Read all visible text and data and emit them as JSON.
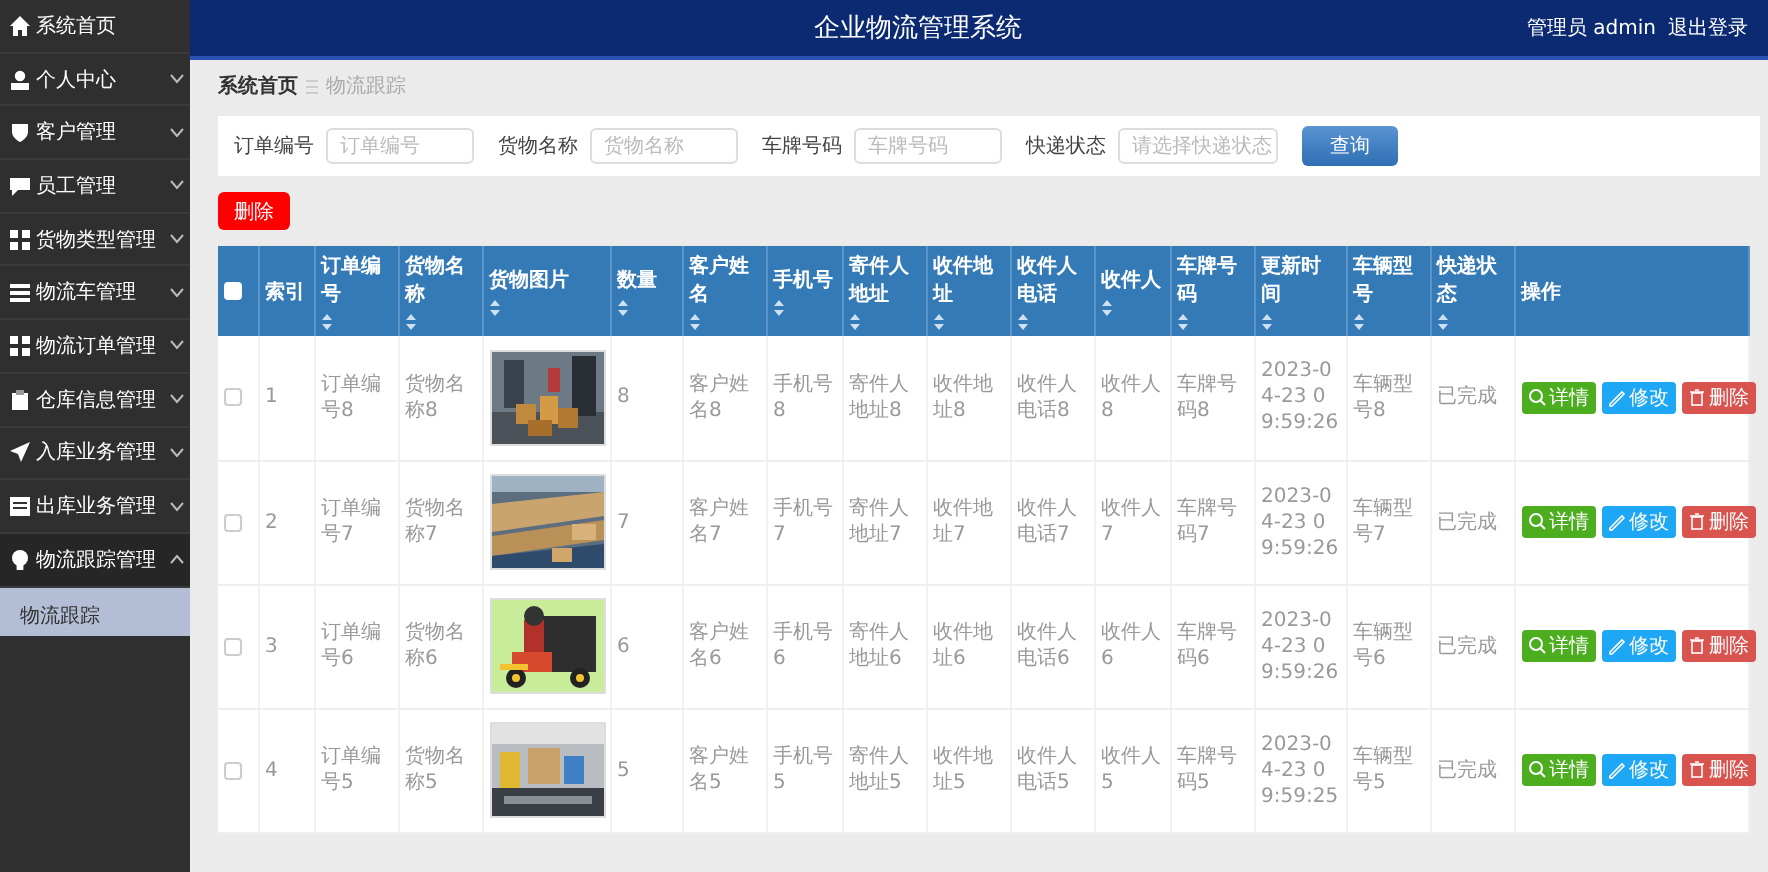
{
  "sidebar": {
    "items": [
      {
        "label": "系统首页",
        "kind": "link"
      },
      {
        "label": "个人中心",
        "kind": "menu",
        "expanded": false
      },
      {
        "label": "客户管理",
        "kind": "menu",
        "expanded": false
      },
      {
        "label": "员工管理",
        "kind": "menu",
        "expanded": false
      },
      {
        "label": "货物类型管理",
        "kind": "menu",
        "expanded": false
      },
      {
        "label": "物流车管理",
        "kind": "menu",
        "expanded": false
      },
      {
        "label": "物流订单管理",
        "kind": "menu",
        "expanded": false
      },
      {
        "label": "仓库信息管理",
        "kind": "menu",
        "expanded": false
      },
      {
        "label": "入库业务管理",
        "kind": "menu",
        "expanded": false
      },
      {
        "label": "出库业务管理",
        "kind": "menu",
        "expanded": false
      },
      {
        "label": "物流跟踪管理",
        "kind": "menu",
        "expanded": true,
        "children": [
          {
            "label": "物流跟踪",
            "selected": true
          }
        ]
      }
    ]
  },
  "header": {
    "title": "企业物流管理系统",
    "user": "管理员 admin",
    "logout": "退出登录"
  },
  "breadcrumb": [
    "系统首页",
    "物流跟踪"
  ],
  "search": {
    "fields": [
      {
        "label": "订单编号",
        "placeholder": "订单编号",
        "kind": "text"
      },
      {
        "label": "货物名称",
        "placeholder": "货物名称",
        "kind": "text"
      },
      {
        "label": "车牌号码",
        "placeholder": "车牌号码",
        "kind": "text"
      },
      {
        "label": "快递状态",
        "placeholder": "请选择快递状态",
        "kind": "select"
      }
    ],
    "button": "查询"
  },
  "delete_button": "删除",
  "table": {
    "select_all": {
      "checked": false
    },
    "columns": [
      {
        "label": "索引",
        "sortable": false
      },
      {
        "label": "订单编号",
        "sortable": true
      },
      {
        "label": "货物名称",
        "sortable": true
      },
      {
        "label": "货物图片",
        "sortable": true
      },
      {
        "label": "数量",
        "sortable": true
      },
      {
        "label": "客户姓名",
        "sortable": true
      },
      {
        "label": "手机号",
        "sortable": true
      },
      {
        "label": "寄件人地址",
        "sortable": true
      },
      {
        "label": "收件地址",
        "sortable": true
      },
      {
        "label": "收件人电话",
        "sortable": true
      },
      {
        "label": "收件人",
        "sortable": true
      },
      {
        "label": "车牌号码",
        "sortable": true
      },
      {
        "label": "更新时间",
        "sortable": true
      },
      {
        "label": "车辆型号",
        "sortable": true
      },
      {
        "label": "快递状态",
        "sortable": true
      },
      {
        "label": "操作",
        "sortable": false
      }
    ],
    "rows": [
      {
        "checked": false,
        "cells": [
          "1",
          "订单编号8",
          "货物名称8",
          {
            "kind": "picture"
          },
          "8",
          "客户姓名8",
          "手机号8",
          "寄件人地址8",
          "收件地址8",
          "收件人电话8",
          "收件人8",
          "车牌号码8",
          "2023-04-23 09:59:26",
          "车辆型号8",
          "已完成"
        ],
        "actions": [
          {
            "label": "详情",
            "kind": "detail"
          },
          {
            "label": "修改",
            "kind": "edit"
          },
          {
            "label": "删除",
            "kind": "delete"
          }
        ]
      },
      {
        "checked": false,
        "cells": [
          "2",
          "订单编号7",
          "货物名称7",
          {
            "kind": "picture"
          },
          "7",
          "客户姓名7",
          "手机号7",
          "寄件人地址7",
          "收件地址7",
          "收件人电话7",
          "收件人7",
          "车牌号码7",
          "2023-04-23 09:59:26",
          "车辆型号7",
          "已完成"
        ],
        "actions": [
          {
            "label": "详情",
            "kind": "detail"
          },
          {
            "label": "修改",
            "kind": "edit"
          },
          {
            "label": "删除",
            "kind": "delete"
          }
        ]
      },
      {
        "checked": false,
        "cells": [
          "3",
          "订单编号6",
          "货物名称6",
          {
            "kind": "picture"
          },
          "6",
          "客户姓名6",
          "手机号6",
          "寄件人地址6",
          "收件地址6",
          "收件人电话6",
          "收件人6",
          "车牌号码6",
          "2023-04-23 09:59:26",
          "车辆型号6",
          "已完成"
        ],
        "actions": [
          {
            "label": "详情",
            "kind": "detail"
          },
          {
            "label": "修改",
            "kind": "edit"
          },
          {
            "label": "删除",
            "kind": "delete"
          }
        ]
      },
      {
        "checked": false,
        "cells": [
          "4",
          "订单编号5",
          "货物名称5",
          {
            "kind": "picture"
          },
          "5",
          "客户姓名5",
          "手机号5",
          "寄件人地址5",
          "收件地址5",
          "收件人电话5",
          "收件人5",
          "车牌号码5",
          "2023-04-23 09:59:25",
          "车辆型号5",
          "已完成"
        ],
        "actions": [
          {
            "label": "详情",
            "kind": "detail"
          },
          {
            "label": "修改",
            "kind": "edit"
          },
          {
            "label": "删除",
            "kind": "delete"
          }
        ]
      }
    ]
  }
}
